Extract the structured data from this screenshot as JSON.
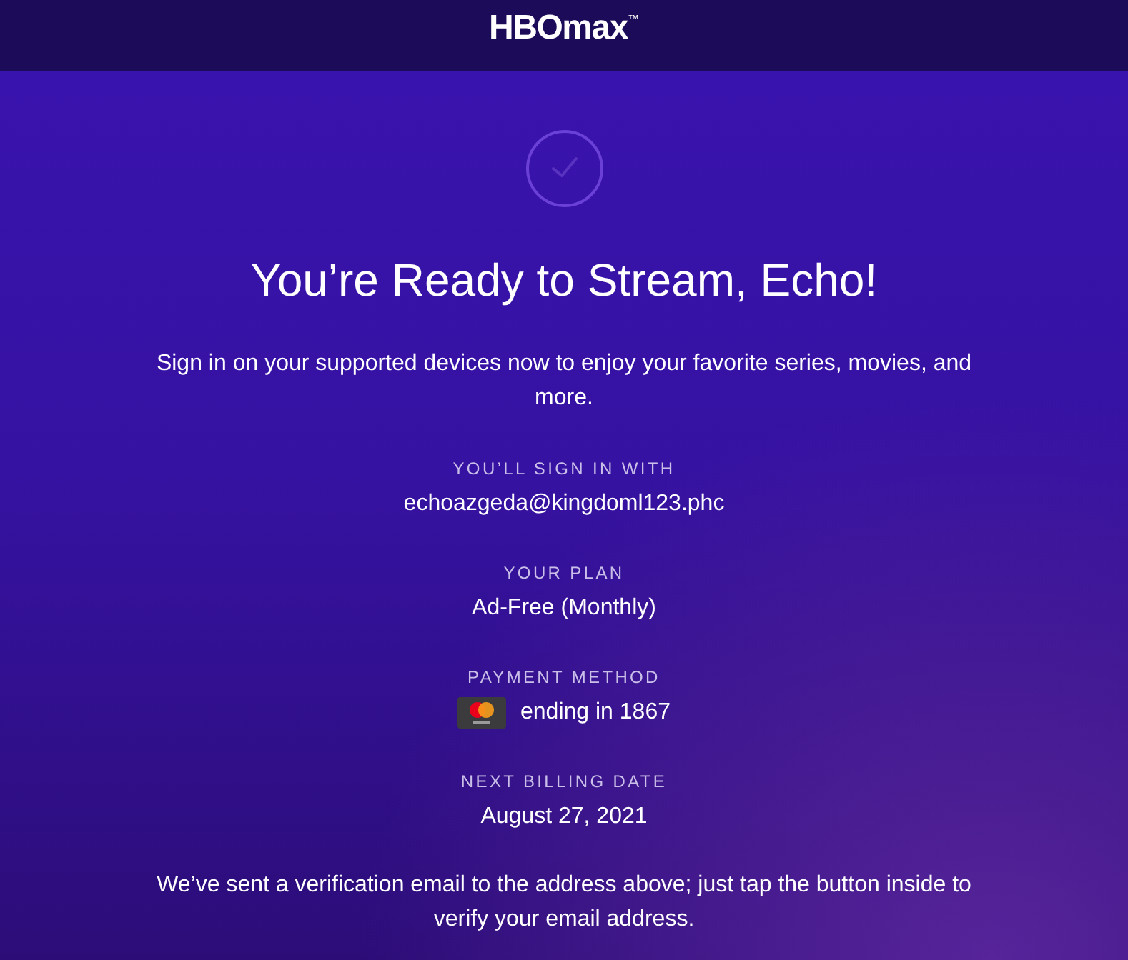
{
  "header": {
    "logo": "HBOmax",
    "trademark": "™"
  },
  "confirmation": {
    "title": "You’re Ready to Stream, Echo!",
    "message": "Sign in on your supported devices now to enjoy your favorite series, movies, and more."
  },
  "details": [
    {
      "kind": "text",
      "label": "YOU’LL SIGN IN WITH",
      "value": "echoazgeda@kingdoml123.phc"
    },
    {
      "kind": "text",
      "label": "YOUR PLAN",
      "value": "Ad-Free (Monthly)"
    },
    {
      "kind": "card",
      "label": "PAYMENT METHOD",
      "value": "ending in 1867"
    },
    {
      "kind": "text",
      "label": "NEXT BILLING DATE",
      "value": "August 27, 2021"
    }
  ],
  "footer_note": "We’ve sent a verification email to the address above; just tap the button inside to verify your email address."
}
